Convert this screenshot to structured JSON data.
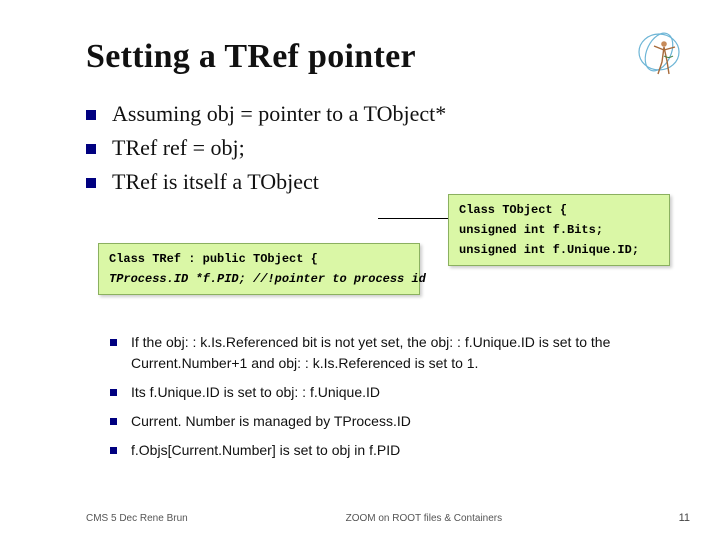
{
  "title": "Setting a TRef pointer",
  "top_bullets": [
    "Assuming  obj = pointer to a TObject*",
    "TRef ref = obj;",
    "TRef is itself a TObject"
  ],
  "code_left": {
    "line1": "Class TRef : public TObject {",
    "line2": "TProcess.ID *f.PID; //!pointer to process id"
  },
  "code_right": {
    "line1": "Class TObject {",
    "line2": "unsigned int f.Bits;",
    "line3": "unsigned int f.Unique.ID;"
  },
  "bottom_bullets": [
    "If the obj: : k.Is.Referenced bit is not yet set, the obj: : f.Unique.ID is set to the Current.Number+1 and obj: : k.Is.Referenced is set to 1.",
    "Its f.Unique.ID is set to obj: : f.Unique.ID",
    "Current. Number is managed by TProcess.ID",
    " f.Objs[Current.Number] is set to obj in f.PID"
  ],
  "footer": {
    "left": "CMS 5 Dec  Rene Brun",
    "center": "ZOOM on ROOT files & Containers",
    "right": "11"
  }
}
